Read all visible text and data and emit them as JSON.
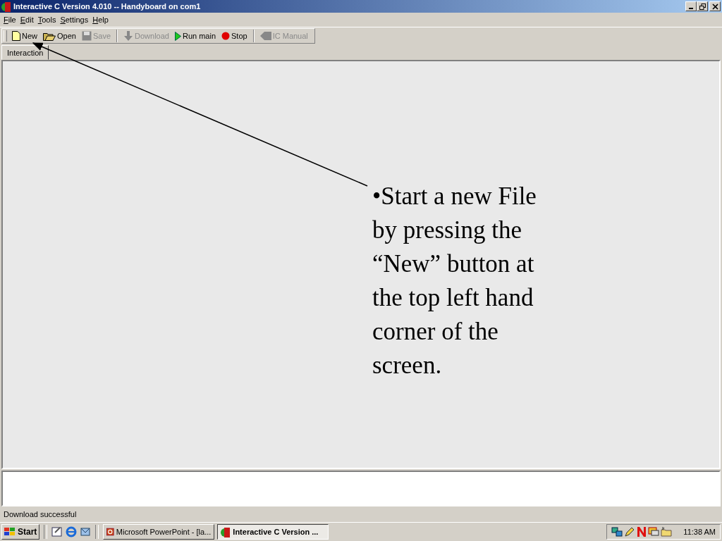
{
  "window": {
    "title": "Interactive C Version 4.010 -- Handyboard on com1"
  },
  "menu": [
    {
      "label": "File"
    },
    {
      "label": "Edit"
    },
    {
      "label": "Tools"
    },
    {
      "label": "Settings"
    },
    {
      "label": "Help"
    }
  ],
  "toolbar": [
    {
      "label": "New",
      "kind": "new",
      "disabled": false,
      "separator_before": false
    },
    {
      "label": "Open",
      "kind": "open",
      "disabled": false,
      "separator_before": false
    },
    {
      "label": "Save",
      "kind": "save",
      "disabled": true,
      "separator_before": false
    },
    {
      "label": "Download",
      "kind": "download",
      "disabled": true,
      "separator_before": true
    },
    {
      "label": "Run main",
      "kind": "run",
      "disabled": false,
      "separator_before": false
    },
    {
      "label": "Stop",
      "kind": "stop",
      "disabled": false,
      "separator_before": false
    },
    {
      "label": "IC Manual",
      "kind": "manual",
      "disabled": true,
      "separator_before": true
    }
  ],
  "tabs": [
    {
      "label": "Interaction",
      "selected": true
    }
  ],
  "annotation": "•Start a new File by pressing the “New” button at the top left hand corner of the screen.",
  "status_bar": "Download successful",
  "taskbar": {
    "start": "Start",
    "tasks": [
      {
        "label": "Microsoft PowerPoint - [la...",
        "kind": "powerpoint",
        "selected": false
      },
      {
        "label": "Interactive C Version ...",
        "kind": "ic",
        "selected": true
      }
    ],
    "clock": "11:38 AM"
  }
}
